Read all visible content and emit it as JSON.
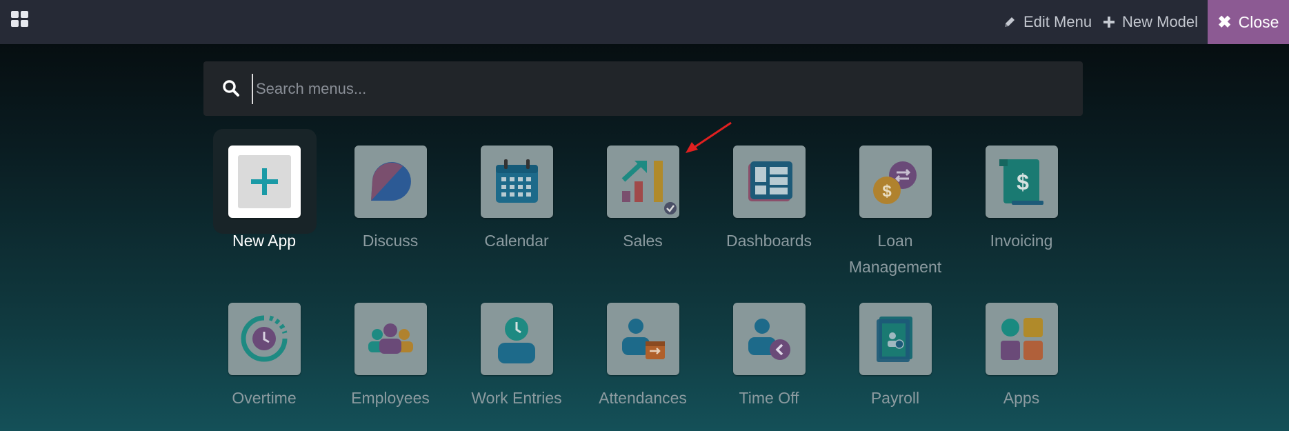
{
  "topbar": {
    "edit_menu_label": "Edit Menu",
    "new_model_label": "New Model",
    "close_label": "Close"
  },
  "search": {
    "placeholder": "Search menus..."
  },
  "apps_row1": [
    {
      "label": "New App",
      "icon": "plus-icon"
    },
    {
      "label": "Discuss",
      "icon": "discuss-icon"
    },
    {
      "label": "Calendar",
      "icon": "calendar-icon"
    },
    {
      "label": "Sales",
      "icon": "sales-chart-icon"
    },
    {
      "label": "Dashboards",
      "icon": "dashboard-icon"
    },
    {
      "label": "Loan Management",
      "icon": "loan-coins-icon"
    },
    {
      "label": "Invoicing",
      "icon": "invoice-dollar-icon"
    }
  ],
  "apps_row2": [
    {
      "label": "Overtime",
      "icon": "overtime-clock-icon"
    },
    {
      "label": "Employees",
      "icon": "employees-icon"
    },
    {
      "label": "Work Entries",
      "icon": "work-entries-icon"
    },
    {
      "label": "Attendances",
      "icon": "attendances-icon"
    },
    {
      "label": "Time Off",
      "icon": "time-off-icon"
    },
    {
      "label": "Payroll",
      "icon": "payroll-icon"
    },
    {
      "label": "Apps",
      "icon": "apps-grid-icon"
    }
  ],
  "colors": {
    "topbar": "#262a36",
    "close_button": "#8c5a93",
    "tile_dim": "#88989a",
    "label_dim": "#8c9ba0",
    "arrow": "#e02020"
  }
}
